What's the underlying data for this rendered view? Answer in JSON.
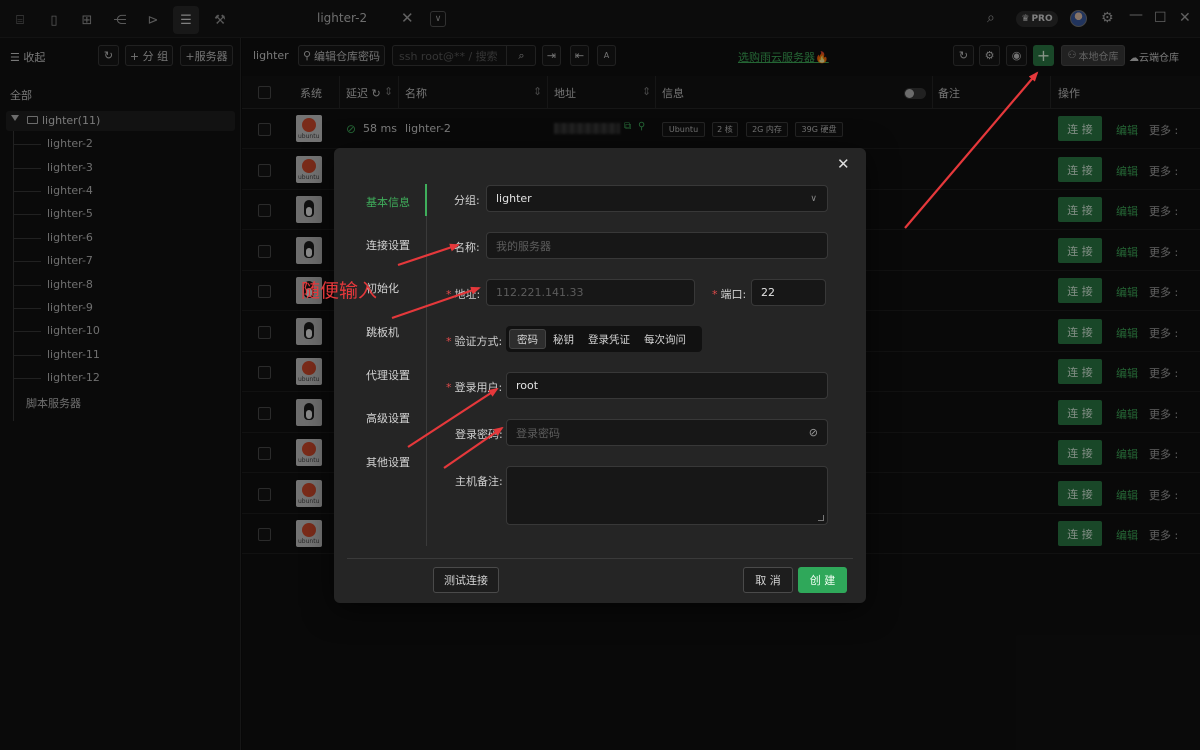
{
  "tabbar": {
    "tab_title": "lighter-2",
    "close_glyph": "✕",
    "dropdown_glyph": "∨",
    "pro_label": "PRO",
    "left_icons": [
      "terminal-icon",
      "file-icon",
      "grid-icon",
      "tree-icon",
      "terminal-box-icon",
      "server-list-icon",
      "wrench-icon"
    ],
    "right_icons": [
      "search-icon",
      "pro-crown-icon",
      "avatar",
      "settings-icon",
      "minimize-icon",
      "maximize-icon",
      "close-icon"
    ]
  },
  "sidebar": {
    "collapse_label": "☰ 收起",
    "add_group_label": "+ 分 组",
    "add_server_label": "+服务器",
    "all_label": "全部",
    "group_label": "lighter(11)",
    "items": [
      "lighter-2",
      "lighter-3",
      "lighter-4",
      "lighter-5",
      "lighter-6",
      "lighter-7",
      "lighter-8",
      "lighter-9",
      "lighter-10",
      "lighter-11",
      "lighter-12"
    ],
    "script_servers_label": "脚本服务器"
  },
  "toolbar": {
    "group_name": "lighter",
    "edit_repo_password": "编辑仓库密码",
    "search_placeholder": "ssh root@** / 搜索",
    "promo_link": "选购雨云服务器🔥",
    "local_repo": "本地仓库",
    "cloud_repo": "云端仓库"
  },
  "table": {
    "headers": {
      "system": "系统",
      "latency": "延迟",
      "name": "名称",
      "address": "地址",
      "info": "信息",
      "note": "备注",
      "actions": "操作"
    },
    "rows": [
      {
        "os": "ubuntu",
        "latency": "58 ms",
        "name": "lighter-2",
        "tags": [
          "Ubuntu",
          "2 核",
          "2G 内存",
          "39G 硬盘"
        ]
      },
      {
        "os": "ubuntu"
      },
      {
        "os": "linux"
      },
      {
        "os": "linux"
      },
      {
        "os": "linux"
      },
      {
        "os": "linux"
      },
      {
        "os": "ubuntu"
      },
      {
        "os": "linux"
      },
      {
        "os": "ubuntu"
      },
      {
        "os": "ubuntu"
      },
      {
        "os": "ubuntu"
      }
    ],
    "connect_label": "连 接",
    "edit_label": "编辑",
    "more_label": "更多 :"
  },
  "dialog": {
    "nav": [
      "基本信息",
      "连接设置",
      "初始化",
      "跳板机",
      "代理设置",
      "高级设置",
      "其他设置"
    ],
    "group_label": "分组:",
    "group_value": "lighter",
    "name_label": "名称:",
    "name_placeholder": "我的服务器",
    "address_label": "地址:",
    "address_placeholder": "112.221.141.33",
    "port_label": "端口:",
    "port_value": "22",
    "auth_label": "验证方式:",
    "auth_options": [
      "密码",
      "秘钥",
      "登录凭证",
      "每次询问"
    ],
    "auth_selected": "密码",
    "user_label": "登录用户:",
    "user_value": "root",
    "password_label": "登录密码:",
    "password_placeholder": "登录密码",
    "remark_label": "主机备注:",
    "test_button": "测试连接",
    "cancel_button": "取 消",
    "create_button": "创 建"
  },
  "annotation": {
    "text": "随便输入",
    "color": "#e5383b"
  },
  "colors": {
    "accent": "#3fae5b",
    "button_green": "#2b7a45",
    "required": "#e04a4a"
  }
}
